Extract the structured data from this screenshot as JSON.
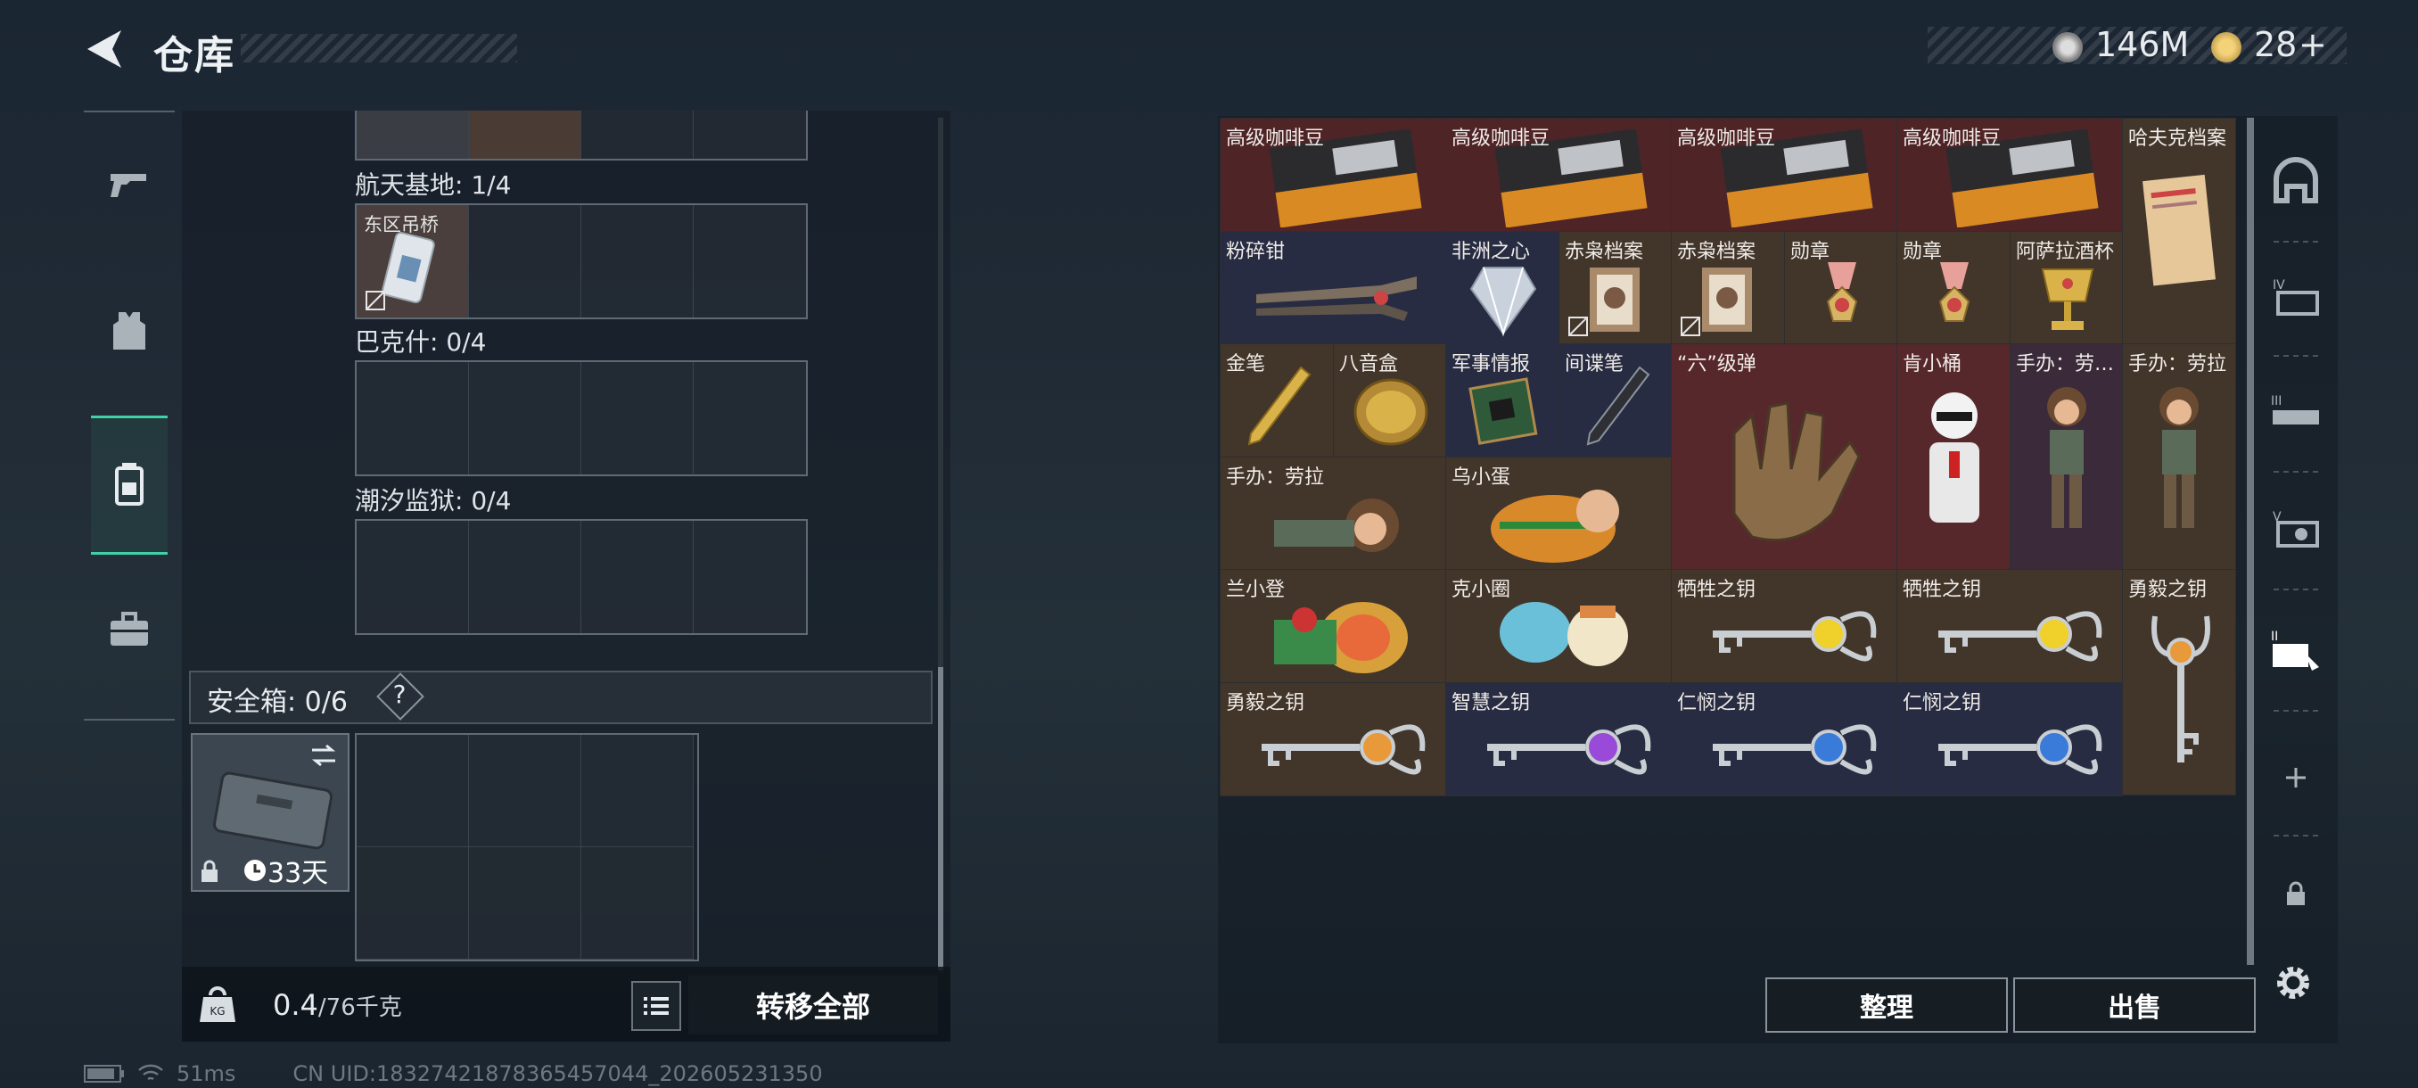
{
  "header": {
    "title": "仓库"
  },
  "currency": {
    "coins": "146M",
    "tokens": "28",
    "plus": "+"
  },
  "left_nav": [
    "gun-icon",
    "armor-icon",
    "backpack-icon",
    "toolbox-icon"
  ],
  "stash_sections": [
    {
      "label": "航天基地: 1/4",
      "first_item": "东区吊桥"
    },
    {
      "label": "巴克什: 0/4"
    },
    {
      "label": "潮汐监狱: 0/4"
    }
  ],
  "safebox": {
    "label": "安全箱: 0/6",
    "help": "?",
    "days": "33天"
  },
  "bottom": {
    "weight": "0.4",
    "weight_max": "/76千克",
    "transfer_all": "转移全部"
  },
  "status": {
    "ping": "51ms",
    "uid": "CN UID:183274218783654570​44_202605231350"
  },
  "items": [
    {
      "name": "高级咖啡豆"
    },
    {
      "name": "高级咖啡豆"
    },
    {
      "name": "高级咖啡豆"
    },
    {
      "name": "高级咖啡豆"
    },
    {
      "name": "哈夫克档案"
    },
    {
      "name": "粉碎钳"
    },
    {
      "name": "非洲之心"
    },
    {
      "name": "赤枭档案"
    },
    {
      "name": "赤枭档案"
    },
    {
      "name": "勋章"
    },
    {
      "name": "勋章"
    },
    {
      "name": "阿萨拉酒杯"
    },
    {
      "name": "金笔"
    },
    {
      "name": "八音盒"
    },
    {
      "name": "军事情报"
    },
    {
      "name": "间谍笔"
    },
    {
      "name": "“六”级弹"
    },
    {
      "name": "肯小桶"
    },
    {
      "name": "手办：劳…"
    },
    {
      "name": "手办：劳拉"
    },
    {
      "name": "手办：劳拉"
    },
    {
      "name": "乌小蛋"
    },
    {
      "name": "兰小登"
    },
    {
      "name": "克小圈"
    },
    {
      "name": "牺牲之钥"
    },
    {
      "name": "牺牲之钥"
    },
    {
      "name": "勇毅之钥"
    },
    {
      "name": "勇毅之钥"
    },
    {
      "name": "智慧之钥"
    },
    {
      "name": "仁悯之钥"
    },
    {
      "name": "仁悯之钥"
    }
  ],
  "actions": {
    "sort": "整理",
    "sell": "出售"
  },
  "right_nav": [
    "helmet-tab-icon",
    "tier-4-tab-icon",
    "tier-3-tab-icon",
    "tier-5-tab-icon",
    "tier-2-tab-icon",
    "add-icon",
    "lock-icon",
    "settings-icon"
  ]
}
